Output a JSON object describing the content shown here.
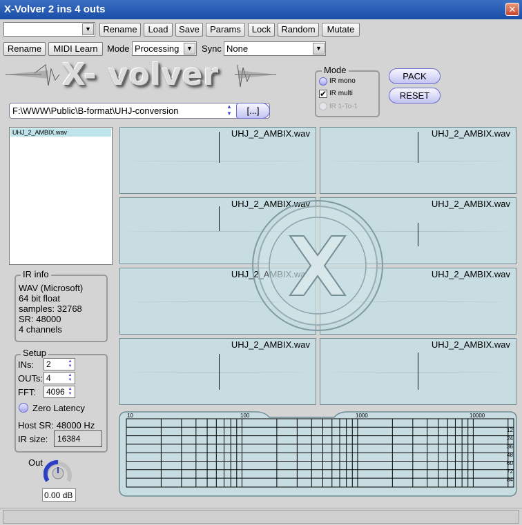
{
  "window": {
    "title": "X-Volver 2 ins 4 outs",
    "close": "✕"
  },
  "toolbar1": {
    "preset_value": "",
    "buttons": [
      "Rename",
      "Load",
      "Save",
      "Params",
      "Lock",
      "Random",
      "Mutate"
    ]
  },
  "toolbar2": {
    "rename": "Rename",
    "midi": "MIDI Learn",
    "mode_label": "Mode",
    "mode_value": "Processing",
    "sync_label": "Sync",
    "sync_value": "None"
  },
  "logo": {
    "text": "X- volver"
  },
  "mode_group": {
    "title": "Mode",
    "options": [
      {
        "label": "IR mono",
        "state": "radio"
      },
      {
        "label": "IR multi",
        "state": "checked"
      },
      {
        "label": "IR 1-To-1",
        "state": "disabled"
      }
    ]
  },
  "actions": {
    "pack": "PACK",
    "reset": "RESET"
  },
  "path": {
    "value": "F:\\WWW\\Public\\B-format\\UHJ-conversion",
    "browse": "[...]"
  },
  "file_list": [
    "UHJ_2_AMBIX.wav"
  ],
  "ir_info": {
    "title": "IR info",
    "lines": [
      "WAV (Microsoft)",
      "64 bit float",
      "samples: 32768",
      "SR: 48000",
      "4 channels"
    ]
  },
  "setup": {
    "title": "Setup",
    "ins_label": "INs:",
    "ins_value": "2",
    "outs_label": "OUTs:",
    "outs_value": "4",
    "fft_label": "FFT:",
    "fft_value": "4096",
    "zero_latency": "Zero Latency",
    "host_sr": "Host SR: 48000 Hz",
    "ir_size_label": "IR size:",
    "ir_size_value": "16384"
  },
  "out": {
    "label": "Out",
    "value": "0.00 dB"
  },
  "ir_panels": [
    "UHJ_2_AMBIX.wav",
    "UHJ_2_AMBIX.wav",
    "UHJ_2_AMBIX.wav",
    "UHJ_2_AMBIX.wav",
    "UHJ_2_AMBIX.wav",
    "UHJ_2_AMBIX.wav",
    "UHJ_2_AMBIX.wav",
    "UHJ_2_AMBIX.wav"
  ],
  "eq": {
    "freq_labels": [
      "10",
      "100",
      "1000",
      "10000"
    ],
    "db_labels": [
      "12",
      "24",
      "36",
      "48",
      "60",
      "72",
      "84"
    ]
  },
  "colors": {
    "titlebar": "#1a4ea7",
    "panel": "#c7dde2",
    "accent": "#6a6acf"
  },
  "icons": {
    "close": "close-icon",
    "dropdown": "chevron-down-icon",
    "knob": "knob-icon"
  }
}
